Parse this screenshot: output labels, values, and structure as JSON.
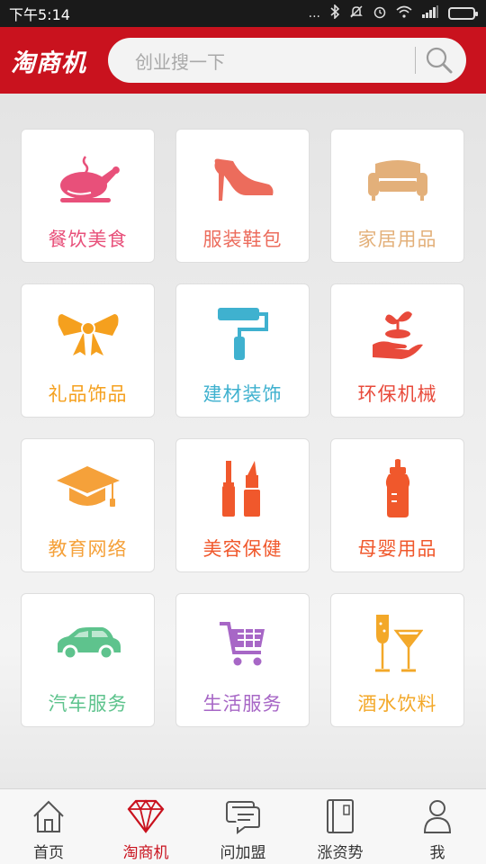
{
  "status_bar": {
    "time": "下午5:14",
    "signal_dots": "...",
    "icons": [
      "bluetooth-icon",
      "mute-icon",
      "alarm-icon",
      "wifi-icon",
      "signal-icon",
      "battery-icon"
    ]
  },
  "header": {
    "logo": "淘商机",
    "search_placeholder": "创业搜一下"
  },
  "categories": [
    {
      "label": "餐饮美食",
      "icon": "roast-chicken-icon",
      "color": "#e8507a"
    },
    {
      "label": "服装鞋包",
      "icon": "high-heel-icon",
      "color": "#ec6c5c"
    },
    {
      "label": "家居用品",
      "icon": "sofa-icon",
      "color": "#e3b07a"
    },
    {
      "label": "礼品饰品",
      "icon": "bow-icon",
      "color": "#f5a01e"
    },
    {
      "label": "建材装饰",
      "icon": "paint-roller-icon",
      "color": "#3fb1cf"
    },
    {
      "label": "环保机械",
      "icon": "plant-hand-icon",
      "color": "#e84a3b"
    },
    {
      "label": "教育网络",
      "icon": "graduation-cap-icon",
      "color": "#f5a13a"
    },
    {
      "label": "美容保健",
      "icon": "cosmetics-icon",
      "color": "#f0582c"
    },
    {
      "label": "母婴用品",
      "icon": "baby-bottle-icon",
      "color": "#f0582c"
    },
    {
      "label": "汽车服务",
      "icon": "car-icon",
      "color": "#5ec38d"
    },
    {
      "label": "生活服务",
      "icon": "shopping-cart-icon",
      "color": "#a767c6"
    },
    {
      "label": "酒水饮料",
      "icon": "wine-glasses-icon",
      "color": "#f3a829"
    }
  ],
  "nav": [
    {
      "label": "首页",
      "icon": "home-icon"
    },
    {
      "label": "淘商机",
      "icon": "diamond-icon",
      "active": true
    },
    {
      "label": "问加盟",
      "icon": "chat-icon"
    },
    {
      "label": "涨资势",
      "icon": "book-icon"
    },
    {
      "label": "我",
      "icon": "person-icon"
    }
  ],
  "colors": {
    "brand": "#c9121e"
  }
}
